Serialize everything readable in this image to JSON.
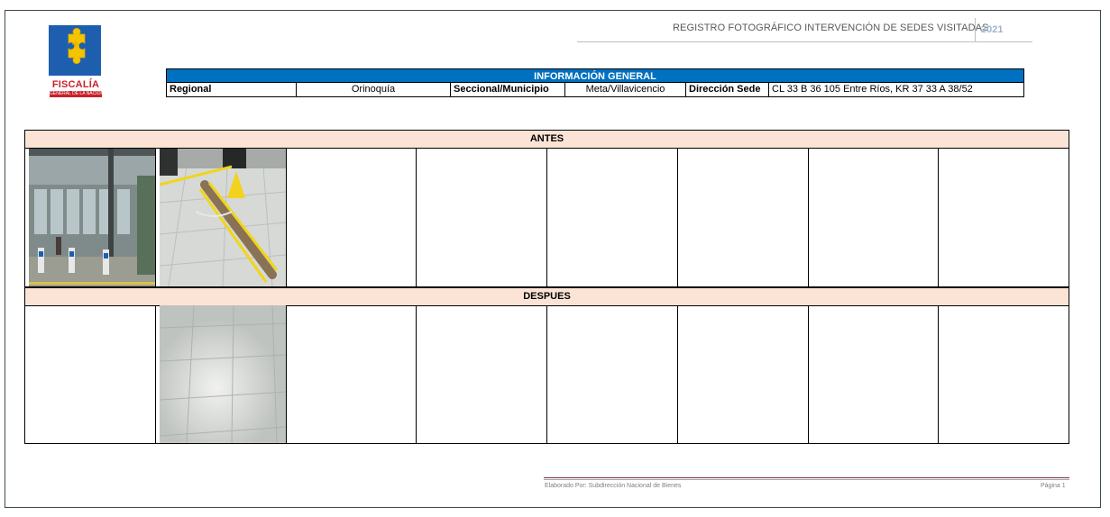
{
  "header": {
    "title": "REGISTRO FOTOGRÁFICO INTERVENCIÓN DE SEDES VISITADAS",
    "year": "2021"
  },
  "logo": {
    "name": "FISCALÍA",
    "subtitle": "GENERAL DE LA NACIÓN",
    "icon": "puzzle-piece-icon",
    "colors": {
      "blue": "#1d5fae",
      "yellow": "#f5c400",
      "red": "#c8202a"
    }
  },
  "info": {
    "heading": "INFORMACIÓN GENERAL",
    "regional_label": "Regional",
    "regional_value": "Orinoquía",
    "seccional_label": "Seccional/Municipio",
    "seccional_value": "Meta/Villavicencio",
    "direccion_label": "Dirección Sede",
    "direccion_value": "CL 33 B 36 105 Entre Ríos, KR 37 33 A 38/52"
  },
  "sections": {
    "before_label": "ANTES",
    "after_label": "DESPUES"
  },
  "photos": {
    "before": [
      "building-facade-photo",
      "floor-with-caution-tape-photo",
      "",
      "",
      "",
      "",
      "",
      ""
    ],
    "after": [
      "",
      "repaired-tile-floor-photo",
      "",
      "",
      "",
      "",
      "",
      ""
    ]
  },
  "footer": {
    "prepared_by": "Elaborado Por: Subdirección Nacional de Bienes",
    "page": "Página 1"
  },
  "colors": {
    "info_header": "#0070c0",
    "section_bar": "#fbe4d5",
    "year_text": "#9fb3cd"
  }
}
